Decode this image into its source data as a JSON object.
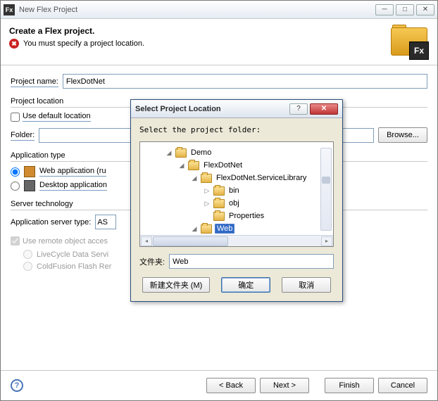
{
  "window": {
    "title": "New Flex Project",
    "icon_text": "Fx"
  },
  "banner": {
    "heading": "Create a Flex project.",
    "error_msg": "You must specify a project location.",
    "logo_text": "Fx"
  },
  "project_name": {
    "label": "Project name:",
    "value": "FlexDotNet"
  },
  "location": {
    "group": "Project location",
    "use_default": "Use default location",
    "folder_label": "Folder:",
    "folder_value": "",
    "browse": "Browse..."
  },
  "app_type": {
    "group": "Application type",
    "web": "Web application (ru",
    "desktop": "Desktop application"
  },
  "server": {
    "group": "Server technology",
    "type_label": "Application server type:",
    "type_value": "AS",
    "remote": "Use remote object acces",
    "lifecycle": "LiveCycle Data Servi",
    "coldfusion": "ColdFusion Flash Rer"
  },
  "wizard": {
    "back": "< Back",
    "next": "Next >",
    "finish": "Finish",
    "cancel": "Cancel"
  },
  "dialog": {
    "title": "Select Project Location",
    "hint": "Select the project folder:",
    "tree": {
      "n0": "Demo",
      "n1": "FlexDotNet",
      "n2": "FlexDotNet.ServiceLibrary",
      "n3": "bin",
      "n4": "obj",
      "n5": "Properties",
      "n6": "Web"
    },
    "field_label": "文件夹:",
    "field_value": "Web",
    "new_folder": "新建文件夹 (M)",
    "ok": "确定",
    "cancel": "取消"
  }
}
